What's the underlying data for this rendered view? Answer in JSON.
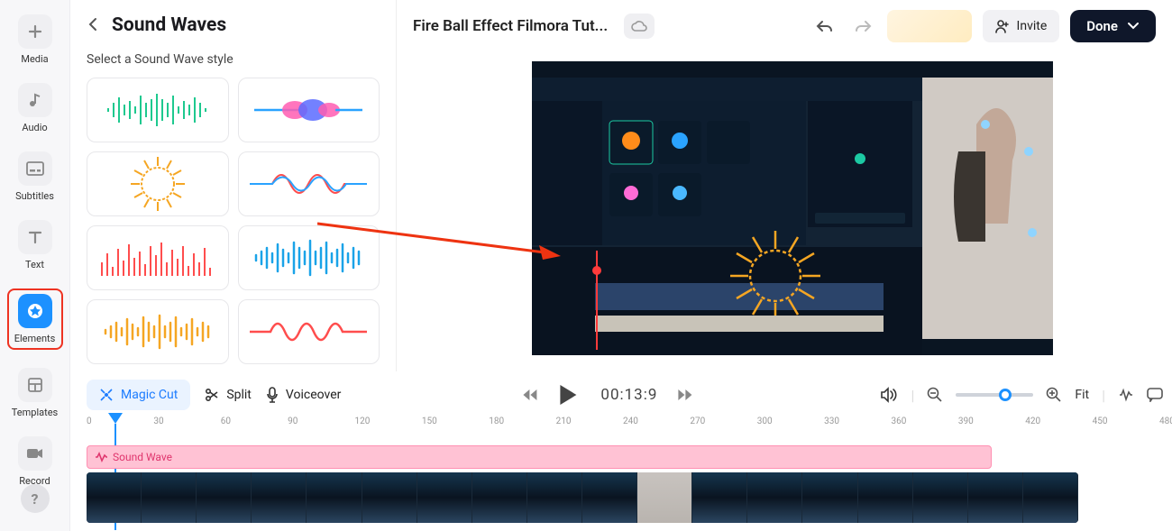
{
  "rail": {
    "items": [
      {
        "label": "Media"
      },
      {
        "label": "Audio"
      },
      {
        "label": "Subtitles"
      },
      {
        "label": "Text"
      },
      {
        "label": "Elements"
      },
      {
        "label": "Templates"
      },
      {
        "label": "Record"
      }
    ],
    "help": "?"
  },
  "panel": {
    "title": "Sound Waves",
    "subtitle": "Select a Sound Wave style"
  },
  "project": {
    "title": "Fire Ball Effect Filmora Tut..."
  },
  "topbar": {
    "invite": "Invite",
    "done": "Done"
  },
  "toolbar": {
    "magic": "Magic Cut",
    "split": "Split",
    "voice": "Voiceover",
    "time": "00:13:9",
    "fit": "Fit"
  },
  "ruler": {
    "ticks": [
      0,
      30,
      60,
      90,
      120,
      150,
      180,
      210,
      240,
      270,
      300,
      330,
      360,
      390,
      420,
      450,
      480
    ]
  },
  "track": {
    "soundwave": "Sound Wave"
  }
}
